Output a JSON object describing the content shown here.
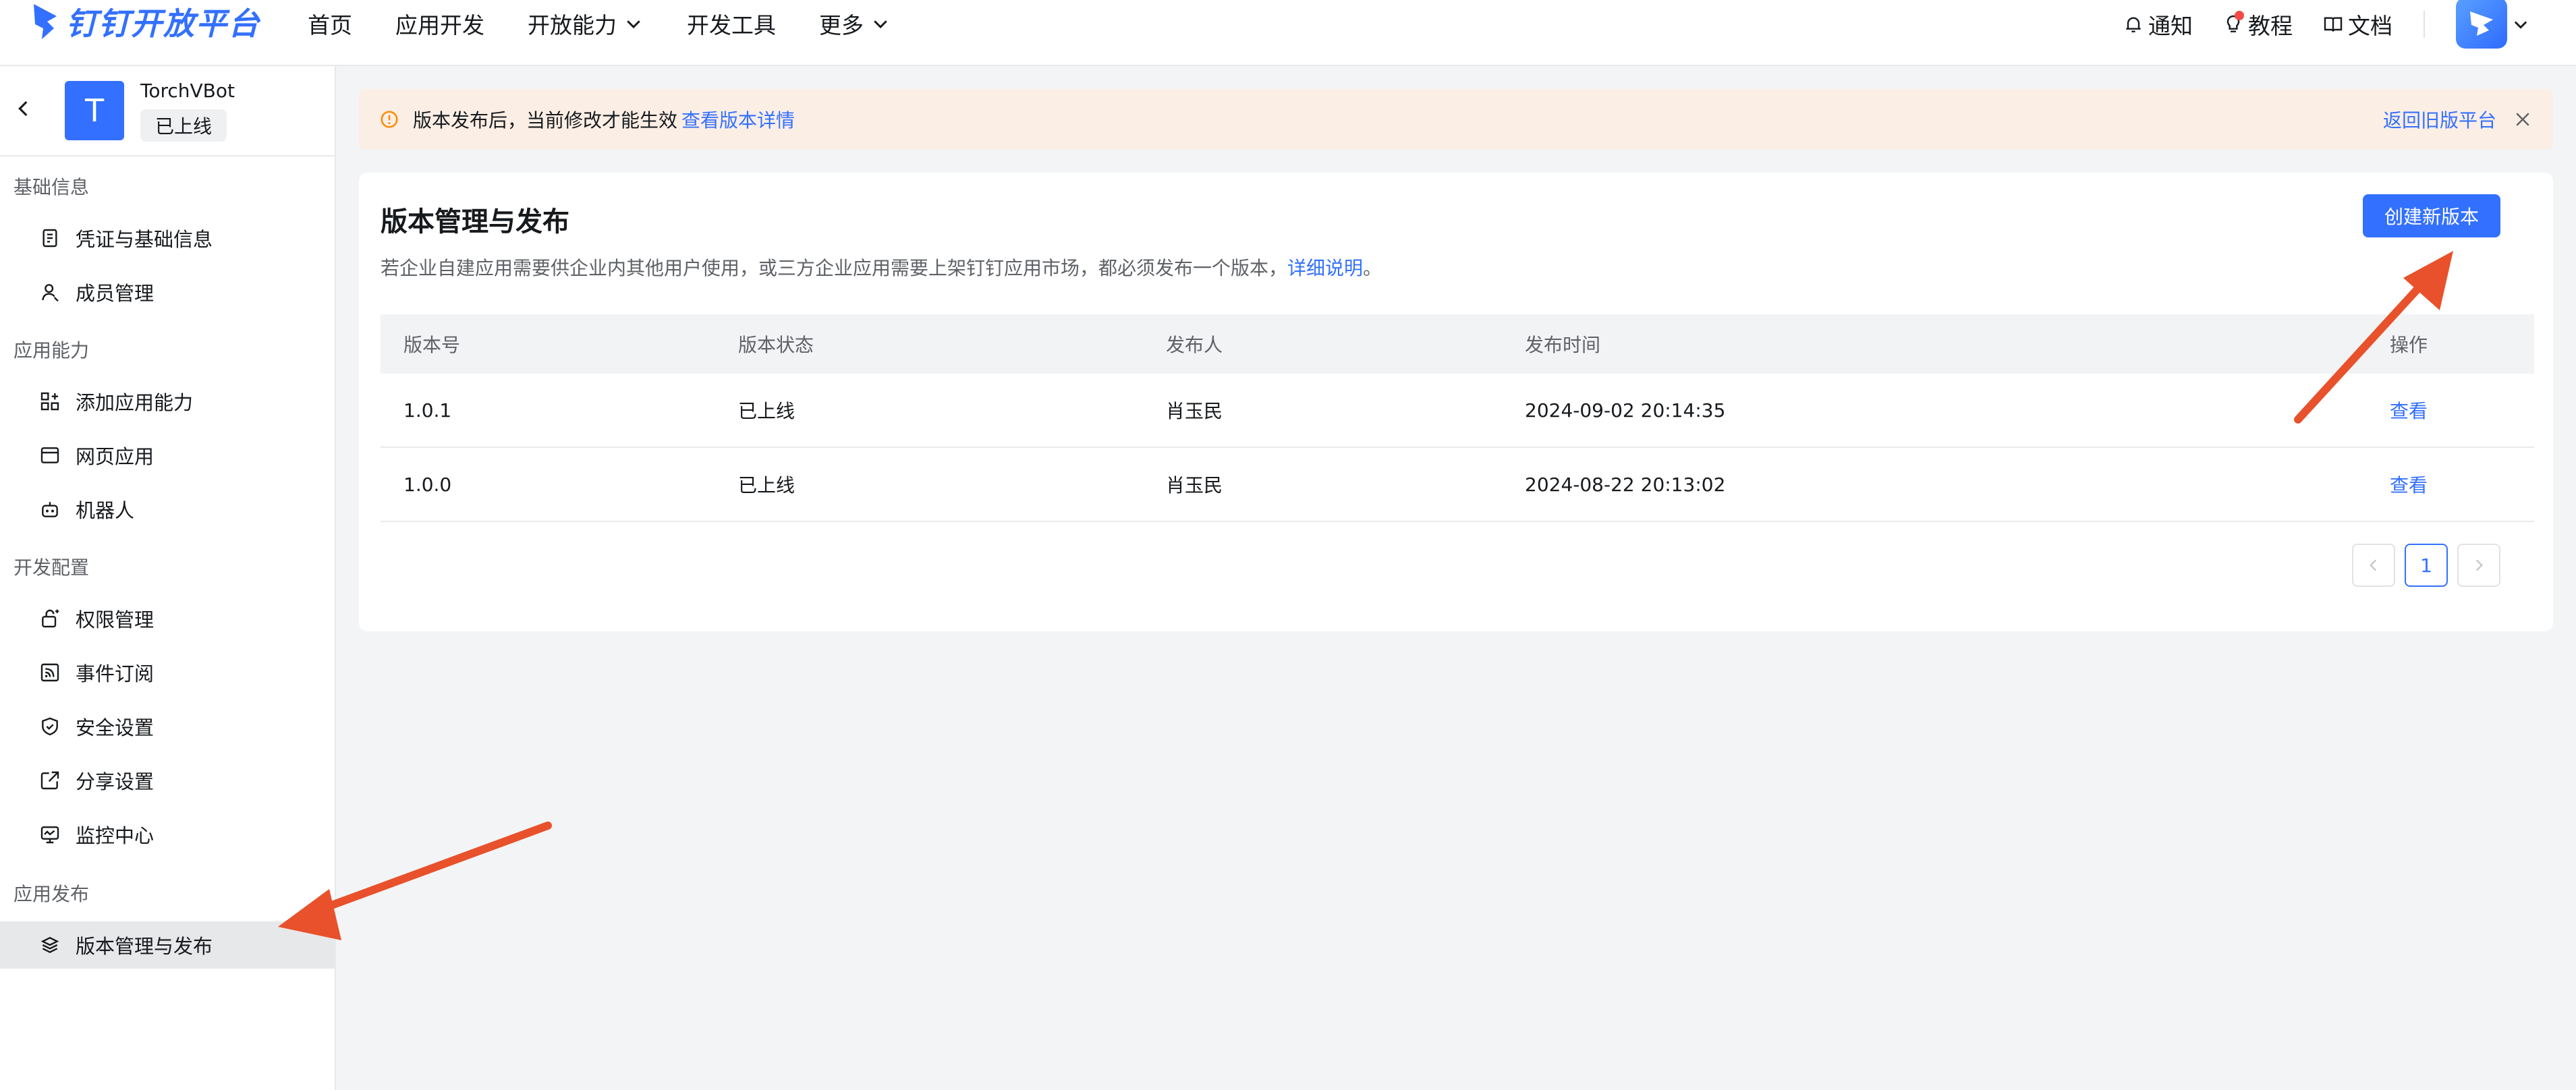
{
  "brand": {
    "logo_text": "钉钉开放平台",
    "color": "#3370ff"
  },
  "topnav": {
    "items": [
      "首页",
      "应用开发",
      "开放能力",
      "开发工具",
      "更多"
    ],
    "right": {
      "notify": "通知",
      "tutorial": "教程",
      "docs": "文档"
    }
  },
  "app": {
    "icon_letter": "T",
    "name": "TorchVBot",
    "status": "已上线"
  },
  "sidebar": {
    "groups": [
      "基础信息",
      "应用能力",
      "开发配置",
      "应用发布"
    ],
    "items": [
      {
        "label": "凭证与基础信息",
        "icon": "credential-icon"
      },
      {
        "label": "成员管理",
        "icon": "user-icon"
      },
      {
        "label": "添加应用能力",
        "icon": "apps-add-icon"
      },
      {
        "label": "网页应用",
        "icon": "webpage-icon"
      },
      {
        "label": "机器人",
        "icon": "robot-icon"
      },
      {
        "label": "权限管理",
        "icon": "lock-icon"
      },
      {
        "label": "事件订阅",
        "icon": "rss-icon"
      },
      {
        "label": "安全设置",
        "icon": "shield-icon"
      },
      {
        "label": "分享设置",
        "icon": "share-icon"
      },
      {
        "label": "监控中心",
        "icon": "monitor-icon"
      },
      {
        "label": "版本管理与发布",
        "icon": "layers-icon",
        "active": true
      }
    ]
  },
  "notice": {
    "text": "版本发布后，当前修改才能生效",
    "link": "查看版本详情",
    "back": "返回旧版平台"
  },
  "main": {
    "title": "版本管理与发布",
    "create_button": "创建新版本",
    "desc": "若企业自建应用需要供企业内其他用户使用，或三方企业应用需要上架钉钉应用市场，都必须发布一个版本，",
    "desc_link": "详细说明",
    "desc_end": "。"
  },
  "table": {
    "headers": [
      "版本号",
      "版本状态",
      "发布人",
      "发布时间",
      "操作"
    ],
    "rows": [
      [
        "1.0.1",
        "已上线",
        "肖玉民",
        "2024-09-02 20:14:35",
        "查看"
      ],
      [
        "1.0.0",
        "已上线",
        "肖玉民",
        "2024-08-22 20:13:02",
        "查看"
      ]
    ]
  },
  "pagination": {
    "current": "1"
  },
  "colors": {
    "accent": "#3370ff",
    "annotation_arrow": "#e8512b",
    "notice_bg": "#fbeee5"
  }
}
